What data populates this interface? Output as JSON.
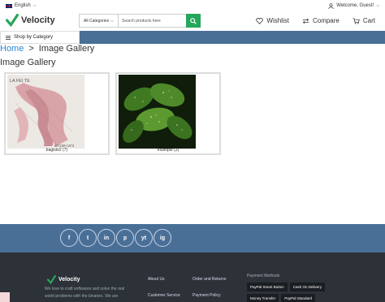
{
  "topbar": {
    "language": "English",
    "welcome": "Welcome, Guest!"
  },
  "header": {
    "logo": "Velocity",
    "search": {
      "category": "All Categories",
      "placeholder": "Search products here"
    },
    "nav": {
      "wishlist": "Wishlist",
      "compare": "Compare",
      "cart": "Cart"
    }
  },
  "catbar": {
    "shop_by_category": "Shop by Category"
  },
  "breadcrumb": {
    "home": "Home",
    "separator": ">",
    "current": "Image Gallery"
  },
  "page": {
    "title": "Image Gallery"
  },
  "gallery": {
    "items": [
      {
        "caption": "bagisto2 (7)",
        "overlay_top": "LA FEI TE",
        "overlay_size": "65*180+10*2"
      },
      {
        "caption": "example (3)"
      }
    ]
  },
  "footer": {
    "social": [
      "f",
      "t",
      "in",
      "p",
      "yt",
      "ig"
    ],
    "brand": "Velocity",
    "tagline": "We love to craft softwares and solve the real world problems with the binaries. We are",
    "links": {
      "about": "About Us",
      "service": "Customer Service",
      "orders": "Order and Returns",
      "payment": "Payment Policy"
    },
    "payment_methods_title": "Payment Methods",
    "payment_methods": [
      "PayPal Smart Button",
      "Cash On Delivery",
      "Money Transfer",
      "PayPal Standard"
    ]
  },
  "colors": {
    "accent_green": "#26a65b",
    "band_blue": "#4a6f97",
    "footer_dark": "#2c3238",
    "link_blue": "#2d86d9"
  }
}
